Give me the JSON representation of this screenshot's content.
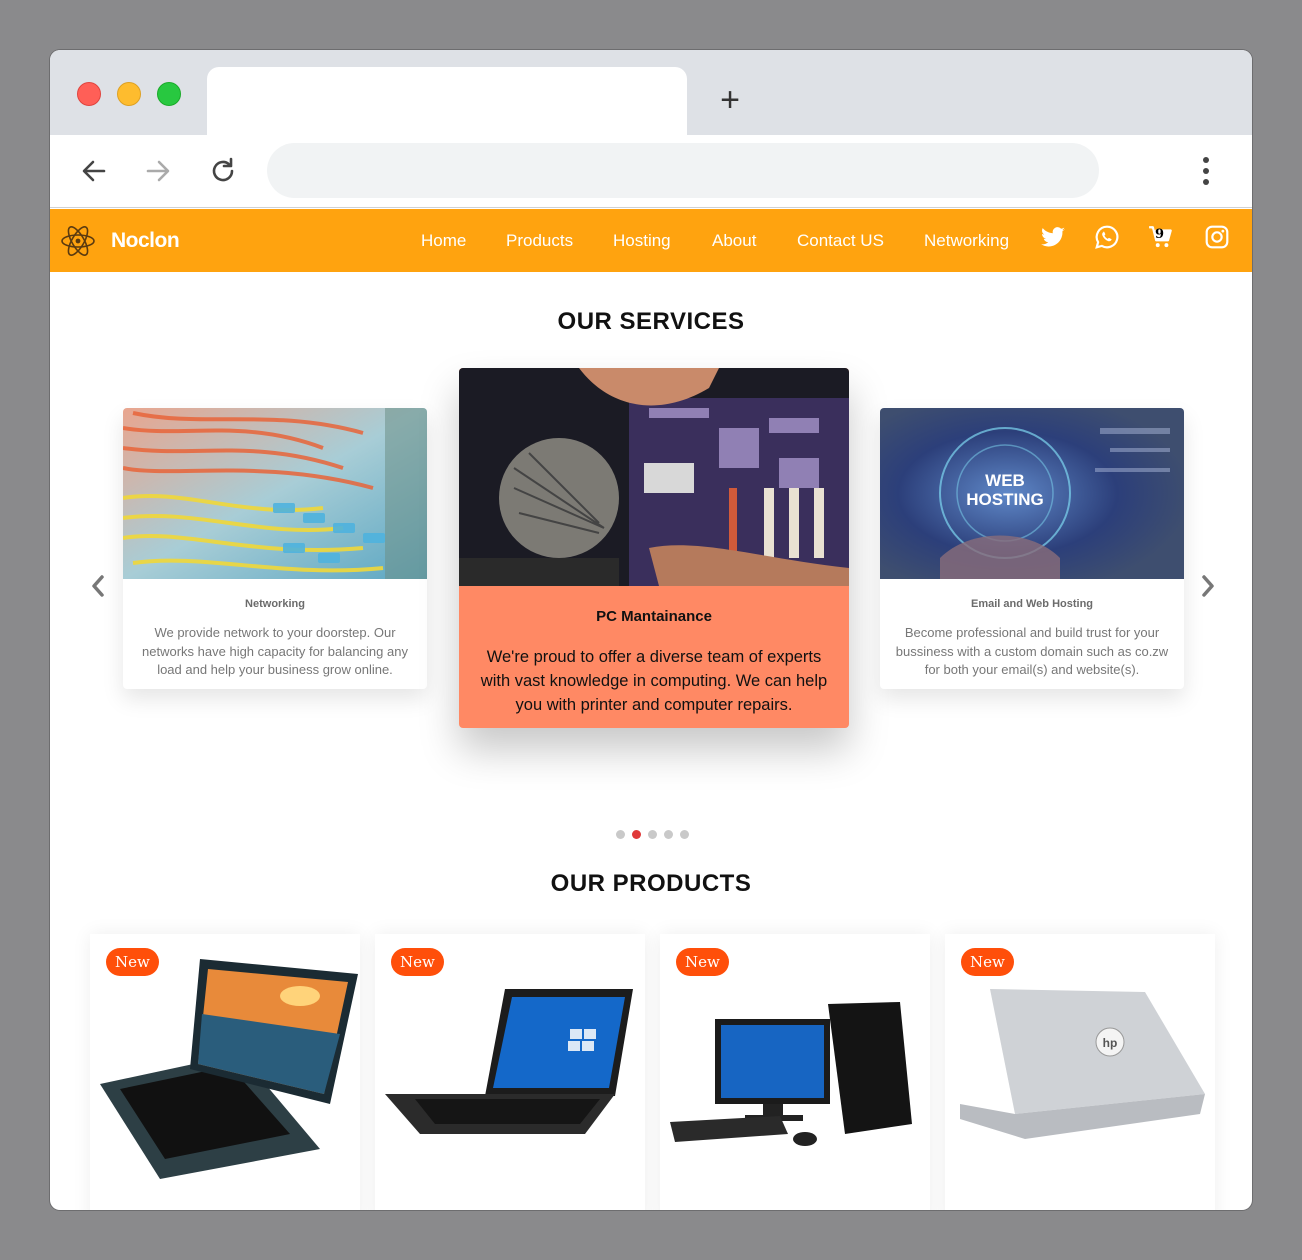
{
  "browser": {
    "new_tab_label": "+",
    "url": ""
  },
  "site": {
    "brand": "Noclon",
    "nav": [
      "Home",
      "Products",
      "Hosting",
      "About",
      "Contact US",
      "Networking"
    ],
    "cart_count": "9",
    "social_icons": [
      "twitter-icon",
      "whatsapp-icon",
      "cart-icon",
      "instagram-icon"
    ],
    "accent_color": "#ffa30f"
  },
  "services": {
    "heading": "OUR SERVICES",
    "cards": [
      {
        "title": "Networking",
        "description": "We provide network to your doorstep. Our networks have high capacity for balancing any load and help your business grow online."
      },
      {
        "title": "PC Mantainance",
        "description": "We're proud to offer a diverse team of experts with vast knowledge in computing. We can help you with printer and computer repairs."
      },
      {
        "title": "Email and Web Hosting",
        "description": "Become professional and build trust for your bussiness with a custom domain such as co.zw for both your email(s) and website(s).",
        "image_text": [
          "WEB",
          "HOSTING"
        ]
      }
    ],
    "pager": {
      "count": 5,
      "active": 2
    },
    "highlight_color": "#ff8964"
  },
  "products": {
    "heading": "OUR PRODUCTS",
    "items": [
      {
        "badge": "New",
        "image": "convertible-laptop"
      },
      {
        "badge": "New",
        "image": "black-laptop"
      },
      {
        "badge": "New",
        "image": "desktop-computer"
      },
      {
        "badge": "New",
        "image": "silver-laptop"
      }
    ],
    "badge_color": "#ff4f0a"
  }
}
